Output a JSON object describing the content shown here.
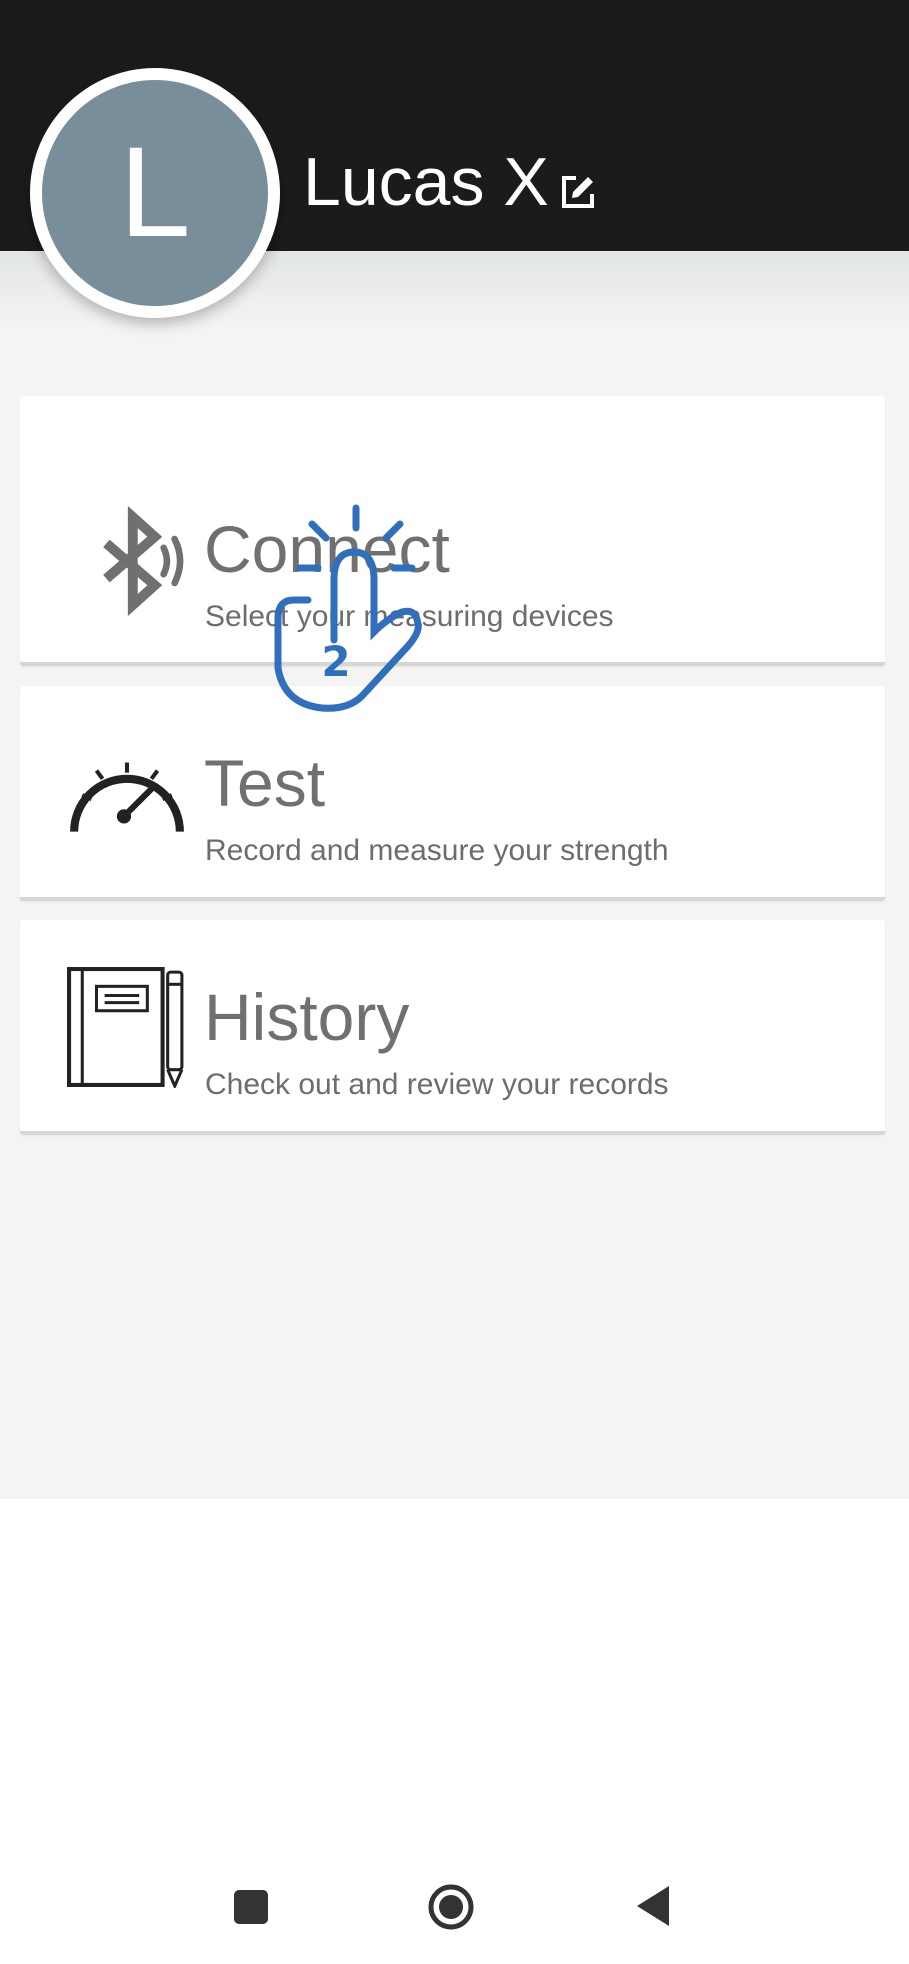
{
  "profile": {
    "avatar_initial": "L",
    "name": "Lucas X",
    "edit_icon": "edit-icon"
  },
  "menu": {
    "items": [
      {
        "id": "connect",
        "title": "Connect",
        "subtitle": "Select your measuring devices",
        "icon": "bluetooth-icon"
      },
      {
        "id": "test",
        "title": "Test",
        "subtitle": "Record and measure your strength",
        "icon": "speedometer-icon"
      },
      {
        "id": "history",
        "title": "History",
        "subtitle": "Check out and review your records",
        "icon": "notebook-icon"
      }
    ]
  },
  "overlay": {
    "tap_indicator_label": "2",
    "icon": "tap-gesture-icon"
  },
  "navbar": {
    "buttons": [
      "recents-icon",
      "home-icon",
      "back-icon"
    ]
  },
  "colors": {
    "header": "#1b1b1b",
    "avatar": "#788f9b",
    "background": "#f4f4f3",
    "card": "#ffffff",
    "text_secondary": "#707070",
    "tap_indicator": "#2f6fbd"
  }
}
